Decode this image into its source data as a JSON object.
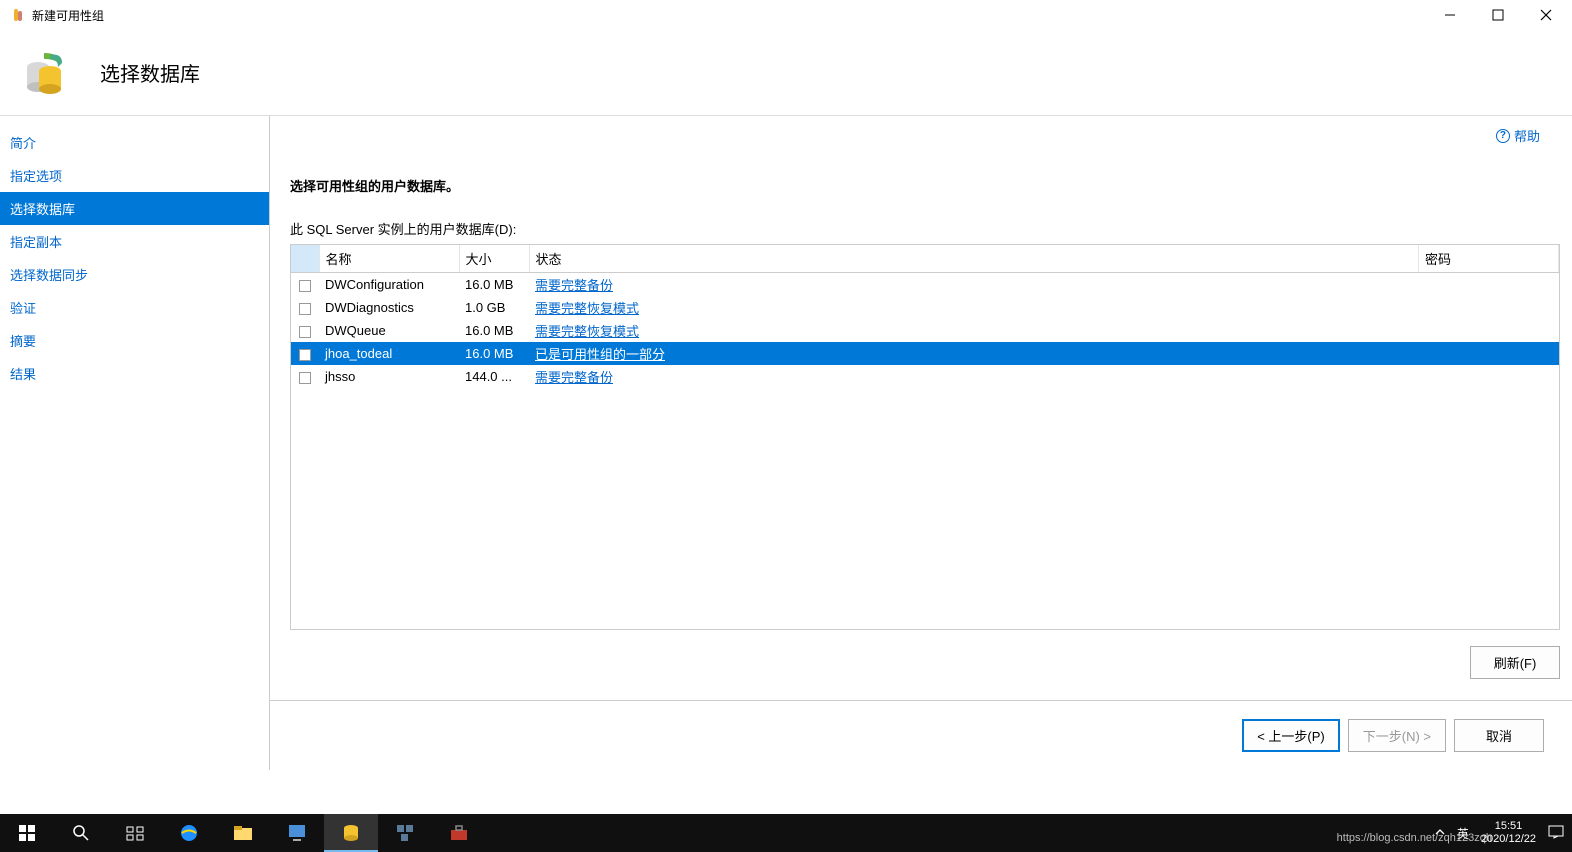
{
  "window": {
    "title": "新建可用性组"
  },
  "header": {
    "title": "选择数据库"
  },
  "help": {
    "label": "帮助"
  },
  "sidebar": {
    "items": [
      {
        "label": "简介"
      },
      {
        "label": "指定选项"
      },
      {
        "label": "选择数据库"
      },
      {
        "label": "指定副本"
      },
      {
        "label": "选择数据同步"
      },
      {
        "label": "验证"
      },
      {
        "label": "摘要"
      },
      {
        "label": "结果"
      }
    ]
  },
  "main": {
    "instruction": "选择可用性组的用户数据库。",
    "subtitle": "此 SQL Server 实例上的用户数据库(D):",
    "columns": {
      "name": "名称",
      "size": "大小",
      "status": "状态",
      "password": "密码"
    },
    "rows": [
      {
        "name": "DWConfiguration",
        "size": "16.0 MB",
        "status": "需要完整备份"
      },
      {
        "name": "DWDiagnostics",
        "size": "1.0 GB",
        "status": "需要完整恢复模式"
      },
      {
        "name": "DWQueue",
        "size": "16.0 MB",
        "status": "需要完整恢复模式"
      },
      {
        "name": "jhoa_todeal",
        "size": "16.0 MB",
        "status": "已是可用性组的一部分"
      },
      {
        "name": "jhsso",
        "size": "144.0 ...",
        "status": "需要完整备份"
      }
    ],
    "refresh_label": "刷新(F)"
  },
  "buttons": {
    "prev": "< 上一步(P)",
    "next": "下一步(N) >",
    "cancel": "取消"
  },
  "taskbar": {
    "time": "15:51",
    "date": "2020/12/22",
    "watermark": "https://blog.csdn.net/zqh123zqh"
  }
}
